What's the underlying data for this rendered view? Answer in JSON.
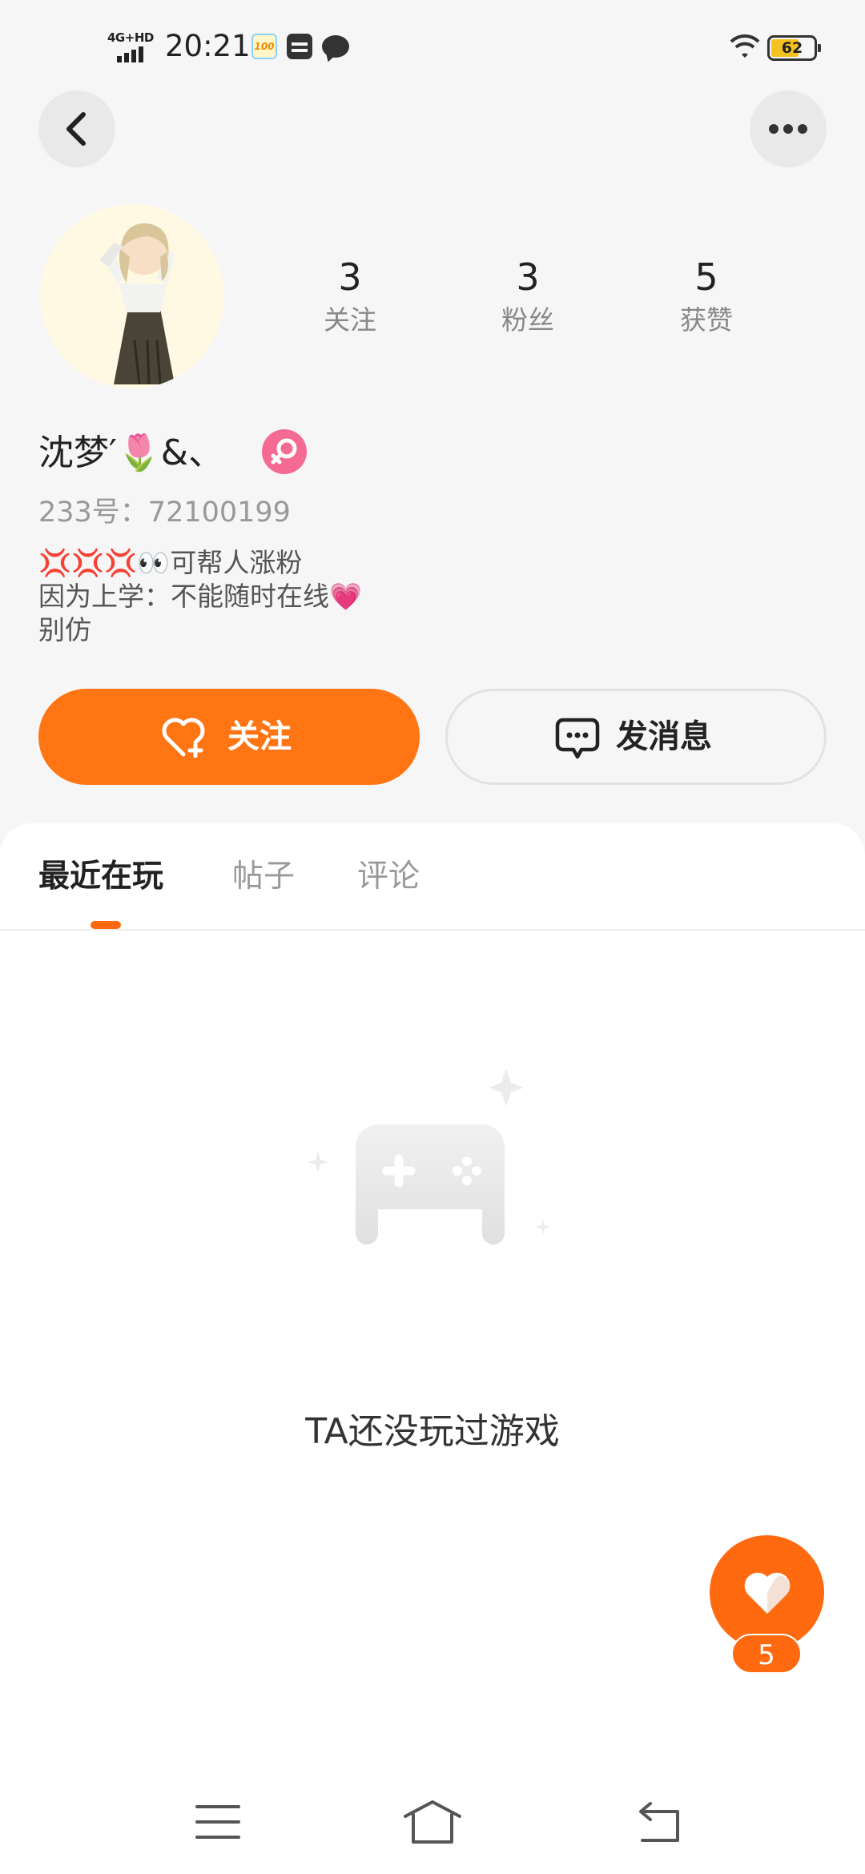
{
  "status_bar": {
    "network": "4G+HD",
    "time": "20:21",
    "notif_icons": [
      "score-app-icon",
      "wallet-icon",
      "message-icon"
    ],
    "notif_badge_text": "100",
    "battery": "62"
  },
  "header": {
    "back_icon": "chevron-left-icon",
    "more_icon": "more-horizontal-icon"
  },
  "profile": {
    "stats": [
      {
        "value": "3",
        "label": "关注"
      },
      {
        "value": "3",
        "label": "粉丝"
      },
      {
        "value": "5",
        "label": "获赞"
      }
    ],
    "nickname": "沈梦′🌷&、",
    "gender": "female",
    "id_text": "233号：72100199",
    "bio": [
      "💢💢💢👀可帮人涨粉",
      "因为上学：不能随时在线💗",
      "别仿"
    ]
  },
  "actions": {
    "follow_label": "关注",
    "message_label": "发消息"
  },
  "tabs": [
    {
      "label": "最近在玩",
      "active": true
    },
    {
      "label": "帖子",
      "active": false
    },
    {
      "label": "评论",
      "active": false
    }
  ],
  "empty_state": {
    "icon": "gamepad-icon",
    "text": "TA还没玩过游戏"
  },
  "like_fab": {
    "count": "5"
  },
  "colors": {
    "accent": "#ff7514",
    "background": "#f6f6f6",
    "panel": "#ffffff",
    "gender_badge": "#f46a92"
  }
}
